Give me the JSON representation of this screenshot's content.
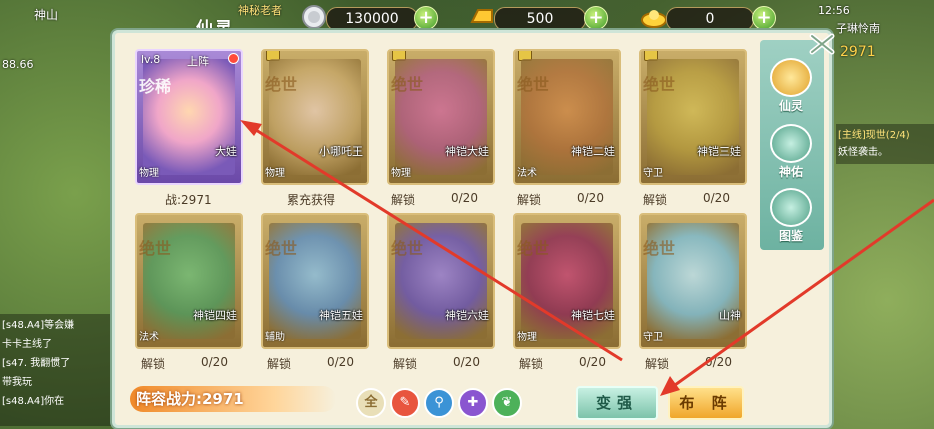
{
  "top": {
    "resources": [
      {
        "icon": "silver-coin-icon",
        "value": "130000"
      },
      {
        "icon": "gold-bar-icon",
        "value": "500"
      },
      {
        "icon": "gold-ingot-icon",
        "value": "0"
      }
    ],
    "time": "12:56",
    "player_name": "子琳怜南",
    "player_power": "2971",
    "left_area": "神山",
    "left_coord": "88.66",
    "npc_label": "神秘老者"
  },
  "panel": {
    "title": "仙灵",
    "cards": [
      {
        "tag": "珍稀",
        "name": "大娃",
        "type": "物理",
        "level": "lv.8",
        "deploy": "上阵",
        "below": "战:2971",
        "active": true
      },
      {
        "tag": "绝世",
        "name": "小哪吒王",
        "type": "物理",
        "below": "累充获得"
      },
      {
        "tag": "绝世",
        "name": "神铠大娃",
        "type": "物理",
        "below": "解锁",
        "count": "0/20"
      },
      {
        "tag": "绝世",
        "name": "神铠二娃",
        "type": "法术",
        "below": "解锁",
        "count": "0/20"
      },
      {
        "tag": "绝世",
        "name": "神铠三娃",
        "type": "守卫",
        "below": "解锁",
        "count": "0/20"
      },
      {
        "tag": "绝世",
        "name": "神铠四娃",
        "type": "法术",
        "below": "解锁",
        "count": "0/20"
      },
      {
        "tag": "绝世",
        "name": "神铠五娃",
        "type": "辅助",
        "below": "解锁",
        "count": "0/20"
      },
      {
        "tag": "绝世",
        "name": "神铠六娃",
        "type": "",
        "below": "解锁",
        "count": "0/20"
      },
      {
        "tag": "绝世",
        "name": "神铠七娃",
        "type": "物理",
        "below": "解锁",
        "count": "0/20"
      },
      {
        "tag": "绝世",
        "name": "山神",
        "type": "守卫",
        "below": "解锁",
        "count": "0/20"
      }
    ],
    "side_tabs": [
      "仙灵",
      "神佑",
      "图鉴"
    ],
    "power_label": "阵容战力:2971",
    "filters": [
      "全",
      "✎",
      "⚲",
      "✚",
      "❦"
    ],
    "buttons": {
      "strengthen": "变强",
      "deploy": "布  阵"
    }
  },
  "chat": [
    {
      "text": "[s48.A4]等会嫌"
    },
    {
      "text": "卡卡主线了"
    },
    {
      "text": "[s47. 我翻惯了"
    },
    {
      "text": "带我玩"
    },
    {
      "text": "[s48.A4]你在"
    }
  ],
  "quest": {
    "title": "[主线]现世(2/4)",
    "desc": "妖怪袭击。"
  },
  "colors": {
    "accent_green": "#3e9a2a",
    "panel_bg": "#f6f0dc",
    "arrow_red": "#e23a2a"
  }
}
